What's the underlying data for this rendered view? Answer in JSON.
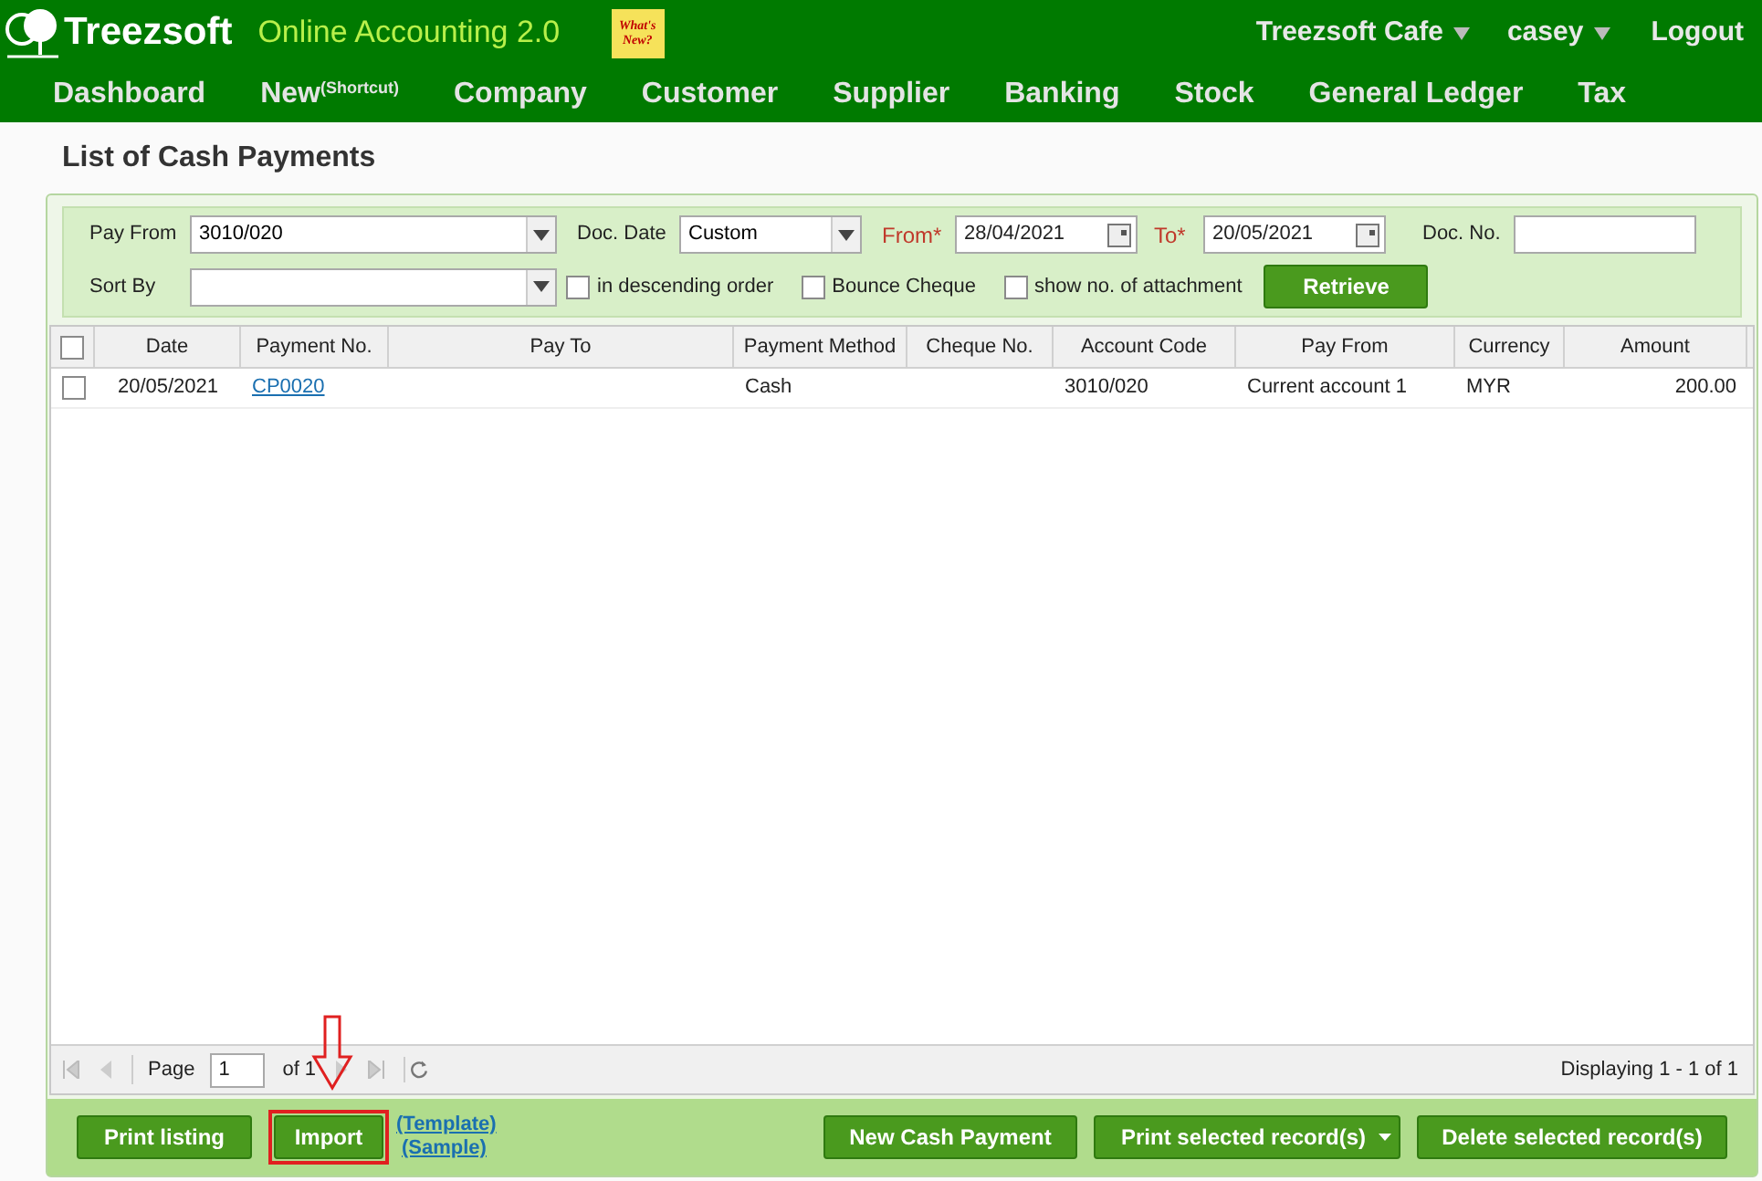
{
  "header": {
    "brand": "Treezsoft",
    "product": "Online Accounting 2.0",
    "note": "What's New?",
    "company": "Treezsoft Cafe",
    "user": "casey",
    "logout": "Logout"
  },
  "nav": [
    {
      "label": "Dashboard"
    },
    {
      "label": "New",
      "sup": "(Shortcut)"
    },
    {
      "label": "Company"
    },
    {
      "label": "Customer"
    },
    {
      "label": "Supplier"
    },
    {
      "label": "Banking"
    },
    {
      "label": "Stock"
    },
    {
      "label": "General Ledger"
    },
    {
      "label": "Tax"
    }
  ],
  "page_title": "List of Cash Payments",
  "filters": {
    "pay_from": {
      "label": "Pay From",
      "value": "3010/020"
    },
    "doc_date": {
      "label": "Doc. Date",
      "value": "Custom"
    },
    "from": {
      "label": "From*",
      "value": "28/04/2021"
    },
    "to": {
      "label": "To*",
      "value": "20/05/2021"
    },
    "doc_no": {
      "label": "Doc. No."
    },
    "sort_by": {
      "label": "Sort By"
    },
    "options": [
      {
        "label": "in descending order",
        "checked": false
      },
      {
        "label": "Bounce Cheque",
        "checked": false
      },
      {
        "label": "show no. of attachment",
        "checked": false
      }
    ],
    "retrieve": "Retrieve"
  },
  "table": {
    "select_all_checked": false,
    "columns": [
      "Date",
      "Payment No.",
      "Pay To",
      "Payment Method",
      "Cheque No.",
      "Account Code",
      "Pay From",
      "Currency",
      "Amount"
    ],
    "rows": [
      {
        "checked": false,
        "cells": [
          "20/05/2021",
          "CP0020",
          "",
          "Cash",
          "",
          "3010/020",
          "Current account 1",
          "MYR",
          "200.00"
        ]
      }
    ]
  },
  "pager": {
    "page_label": "Page",
    "page": "1",
    "of": "of 1",
    "display": "Displaying 1 - 1 of 1"
  },
  "buttons": {
    "print_listing": "Print listing",
    "import": "Import",
    "template": "(Template)",
    "sample": "(Sample)",
    "new": "New Cash Payment",
    "print_selected": "Print selected record(s)",
    "delete_selected": "Delete selected record(s)"
  }
}
